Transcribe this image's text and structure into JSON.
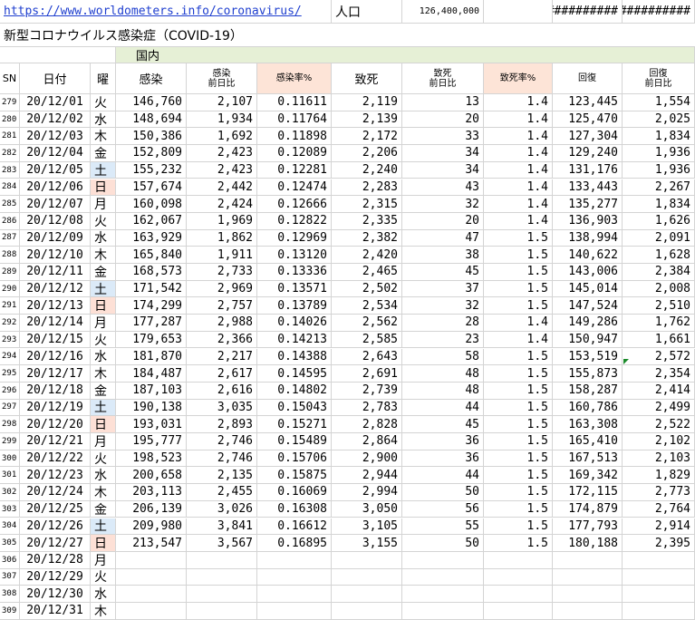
{
  "top": {
    "link_text": "https://www.worldometers.info/coronavirus/",
    "population_label": "人口",
    "population_value": "126,400,000",
    "overflow1": "##########",
    "overflow2": "##########"
  },
  "title": "新型コロナウイルス感染症（COVID-19）",
  "section_label": "国内",
  "headers": {
    "sn": "SN",
    "date": "日付",
    "dow": "曜",
    "cases": "感染",
    "cases_diff_1": "感染",
    "cases_diff_2": "前日比",
    "infection_rate": "感染率%",
    "deaths": "致死",
    "deaths_diff_1": "致死",
    "deaths_diff_2": "前日比",
    "fatality_rate": "致死率%",
    "recovered": "回復",
    "recovered_diff_1": "回復",
    "recovered_diff_2": "前日比"
  },
  "colors": {
    "pink_header": "#fde4d7",
    "saturday": "#dbeaf8",
    "sunday": "#fde0d6",
    "section_green": "#e6f0d6",
    "link": "#1f3fcf"
  },
  "rows": [
    {
      "sn": "279",
      "date": "20/12/01",
      "dow": "火",
      "cases": "146,760",
      "cd": "2,107",
      "rate": "0.11611",
      "deaths": "2,119",
      "dd": "13",
      "fr": "1.4",
      "rec": "123,445",
      "rd": "1,554"
    },
    {
      "sn": "280",
      "date": "20/12/02",
      "dow": "水",
      "cases": "148,694",
      "cd": "1,934",
      "rate": "0.11764",
      "deaths": "2,139",
      "dd": "20",
      "fr": "1.4",
      "rec": "125,470",
      "rd": "2,025"
    },
    {
      "sn": "281",
      "date": "20/12/03",
      "dow": "木",
      "cases": "150,386",
      "cd": "1,692",
      "rate": "0.11898",
      "deaths": "2,172",
      "dd": "33",
      "fr": "1.4",
      "rec": "127,304",
      "rd": "1,834"
    },
    {
      "sn": "282",
      "date": "20/12/04",
      "dow": "金",
      "cases": "152,809",
      "cd": "2,423",
      "rate": "0.12089",
      "deaths": "2,206",
      "dd": "34",
      "fr": "1.4",
      "rec": "129,240",
      "rd": "1,936"
    },
    {
      "sn": "283",
      "date": "20/12/05",
      "dow": "土",
      "cases": "155,232",
      "cd": "2,423",
      "rate": "0.12281",
      "deaths": "2,240",
      "dd": "34",
      "fr": "1.4",
      "rec": "131,176",
      "rd": "1,936"
    },
    {
      "sn": "284",
      "date": "20/12/06",
      "dow": "日",
      "cases": "157,674",
      "cd": "2,442",
      "rate": "0.12474",
      "deaths": "2,283",
      "dd": "43",
      "fr": "1.4",
      "rec": "133,443",
      "rd": "2,267"
    },
    {
      "sn": "285",
      "date": "20/12/07",
      "dow": "月",
      "cases": "160,098",
      "cd": "2,424",
      "rate": "0.12666",
      "deaths": "2,315",
      "dd": "32",
      "fr": "1.4",
      "rec": "135,277",
      "rd": "1,834"
    },
    {
      "sn": "286",
      "date": "20/12/08",
      "dow": "火",
      "cases": "162,067",
      "cd": "1,969",
      "rate": "0.12822",
      "deaths": "2,335",
      "dd": "20",
      "fr": "1.4",
      "rec": "136,903",
      "rd": "1,626"
    },
    {
      "sn": "287",
      "date": "20/12/09",
      "dow": "水",
      "cases": "163,929",
      "cd": "1,862",
      "rate": "0.12969",
      "deaths": "2,382",
      "dd": "47",
      "fr": "1.5",
      "rec": "138,994",
      "rd": "2,091"
    },
    {
      "sn": "288",
      "date": "20/12/10",
      "dow": "木",
      "cases": "165,840",
      "cd": "1,911",
      "rate": "0.13120",
      "deaths": "2,420",
      "dd": "38",
      "fr": "1.5",
      "rec": "140,622",
      "rd": "1,628"
    },
    {
      "sn": "289",
      "date": "20/12/11",
      "dow": "金",
      "cases": "168,573",
      "cd": "2,733",
      "rate": "0.13336",
      "deaths": "2,465",
      "dd": "45",
      "fr": "1.5",
      "rec": "143,006",
      "rd": "2,384"
    },
    {
      "sn": "290",
      "date": "20/12/12",
      "dow": "土",
      "cases": "171,542",
      "cd": "2,969",
      "rate": "0.13571",
      "deaths": "2,502",
      "dd": "37",
      "fr": "1.5",
      "rec": "145,014",
      "rd": "2,008"
    },
    {
      "sn": "291",
      "date": "20/12/13",
      "dow": "日",
      "cases": "174,299",
      "cd": "2,757",
      "rate": "0.13789",
      "deaths": "2,534",
      "dd": "32",
      "fr": "1.5",
      "rec": "147,524",
      "rd": "2,510"
    },
    {
      "sn": "292",
      "date": "20/12/14",
      "dow": "月",
      "cases": "177,287",
      "cd": "2,988",
      "rate": "0.14026",
      "deaths": "2,562",
      "dd": "28",
      "fr": "1.4",
      "rec": "149,286",
      "rd": "1,762"
    },
    {
      "sn": "293",
      "date": "20/12/15",
      "dow": "火",
      "cases": "179,653",
      "cd": "2,366",
      "rate": "0.14213",
      "deaths": "2,585",
      "dd": "23",
      "fr": "1.4",
      "rec": "150,947",
      "rd": "1,661"
    },
    {
      "sn": "294",
      "date": "20/12/16",
      "dow": "水",
      "cases": "181,870",
      "cd": "2,217",
      "rate": "0.14388",
      "deaths": "2,643",
      "dd": "58",
      "fr": "1.5",
      "rec": "153,519",
      "rd": "2,572"
    },
    {
      "sn": "295",
      "date": "20/12/17",
      "dow": "木",
      "cases": "184,487",
      "cd": "2,617",
      "rate": "0.14595",
      "deaths": "2,691",
      "dd": "48",
      "fr": "1.5",
      "rec": "155,873",
      "rd": "2,354"
    },
    {
      "sn": "296",
      "date": "20/12/18",
      "dow": "金",
      "cases": "187,103",
      "cd": "2,616",
      "rate": "0.14802",
      "deaths": "2,739",
      "dd": "48",
      "fr": "1.5",
      "rec": "158,287",
      "rd": "2,414"
    },
    {
      "sn": "297",
      "date": "20/12/19",
      "dow": "土",
      "cases": "190,138",
      "cd": "3,035",
      "rate": "0.15043",
      "deaths": "2,783",
      "dd": "44",
      "fr": "1.5",
      "rec": "160,786",
      "rd": "2,499"
    },
    {
      "sn": "298",
      "date": "20/12/20",
      "dow": "日",
      "cases": "193,031",
      "cd": "2,893",
      "rate": "0.15271",
      "deaths": "2,828",
      "dd": "45",
      "fr": "1.5",
      "rec": "163,308",
      "rd": "2,522"
    },
    {
      "sn": "299",
      "date": "20/12/21",
      "dow": "月",
      "cases": "195,777",
      "cd": "2,746",
      "rate": "0.15489",
      "deaths": "2,864",
      "dd": "36",
      "fr": "1.5",
      "rec": "165,410",
      "rd": "2,102"
    },
    {
      "sn": "300",
      "date": "20/12/22",
      "dow": "火",
      "cases": "198,523",
      "cd": "2,746",
      "rate": "0.15706",
      "deaths": "2,900",
      "dd": "36",
      "fr": "1.5",
      "rec": "167,513",
      "rd": "2,103"
    },
    {
      "sn": "301",
      "date": "20/12/23",
      "dow": "水",
      "cases": "200,658",
      "cd": "2,135",
      "rate": "0.15875",
      "deaths": "2,944",
      "dd": "44",
      "fr": "1.5",
      "rec": "169,342",
      "rd": "1,829"
    },
    {
      "sn": "302",
      "date": "20/12/24",
      "dow": "木",
      "cases": "203,113",
      "cd": "2,455",
      "rate": "0.16069",
      "deaths": "2,994",
      "dd": "50",
      "fr": "1.5",
      "rec": "172,115",
      "rd": "2,773"
    },
    {
      "sn": "303",
      "date": "20/12/25",
      "dow": "金",
      "cases": "206,139",
      "cd": "3,026",
      "rate": "0.16308",
      "deaths": "3,050",
      "dd": "56",
      "fr": "1.5",
      "rec": "174,879",
      "rd": "2,764"
    },
    {
      "sn": "304",
      "date": "20/12/26",
      "dow": "土",
      "cases": "209,980",
      "cd": "3,841",
      "rate": "0.16612",
      "deaths": "3,105",
      "dd": "55",
      "fr": "1.5",
      "rec": "177,793",
      "rd": "2,914"
    },
    {
      "sn": "305",
      "date": "20/12/27",
      "dow": "日",
      "cases": "213,547",
      "cd": "3,567",
      "rate": "0.16895",
      "deaths": "3,155",
      "dd": "50",
      "fr": "1.5",
      "rec": "180,188",
      "rd": "2,395"
    },
    {
      "sn": "306",
      "date": "20/12/28",
      "dow": "月",
      "cases": "",
      "cd": "",
      "rate": "",
      "deaths": "",
      "dd": "",
      "fr": "",
      "rec": "",
      "rd": ""
    },
    {
      "sn": "307",
      "date": "20/12/29",
      "dow": "火",
      "cases": "",
      "cd": "",
      "rate": "",
      "deaths": "",
      "dd": "",
      "fr": "",
      "rec": "",
      "rd": ""
    },
    {
      "sn": "308",
      "date": "20/12/30",
      "dow": "水",
      "cases": "",
      "cd": "",
      "rate": "",
      "deaths": "",
      "dd": "",
      "fr": "",
      "rec": "",
      "rd": ""
    },
    {
      "sn": "309",
      "date": "20/12/31",
      "dow": "木",
      "cases": "",
      "cd": "",
      "rate": "",
      "deaths": "",
      "dd": "",
      "fr": "",
      "rec": "",
      "rd": ""
    }
  ]
}
